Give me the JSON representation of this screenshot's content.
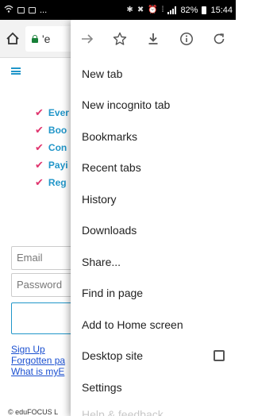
{
  "status_bar": {
    "left_icons": [
      "wifi-calling-icon",
      "image-icon",
      "message-icon"
    ],
    "ellipsis": "...",
    "right_icons": [
      "bluetooth-icon",
      "mute-icon",
      "alarm-icon",
      "lte-icon",
      "signal-icon"
    ],
    "battery": "82%",
    "time": "15:44"
  },
  "toolbar": {
    "url_text": "'e"
  },
  "page": {
    "features": [
      "Ever",
      "Boo",
      "Con",
      "Payi",
      "Reg"
    ],
    "email_placeholder": "Email",
    "password_placeholder": "Password",
    "sign_up": "Sign Up",
    "forgotten": "Forgotten pa",
    "what_is": "What is myE",
    "footer": "© eduFOCUS L"
  },
  "menu": {
    "items": [
      {
        "label": "New tab"
      },
      {
        "label": "New incognito tab"
      },
      {
        "label": "Bookmarks"
      },
      {
        "label": "Recent tabs"
      },
      {
        "label": "History"
      },
      {
        "label": "Downloads"
      },
      {
        "label": "Share..."
      },
      {
        "label": "Find in page"
      },
      {
        "label": "Add to Home screen"
      },
      {
        "label": "Desktop site"
      },
      {
        "label": "Settings"
      },
      {
        "label": "Help & feedback"
      }
    ]
  },
  "colors": {
    "accent": "#2196c9",
    "check": "#e0356e",
    "link": "#1a4fd0",
    "lock": "#188038"
  }
}
